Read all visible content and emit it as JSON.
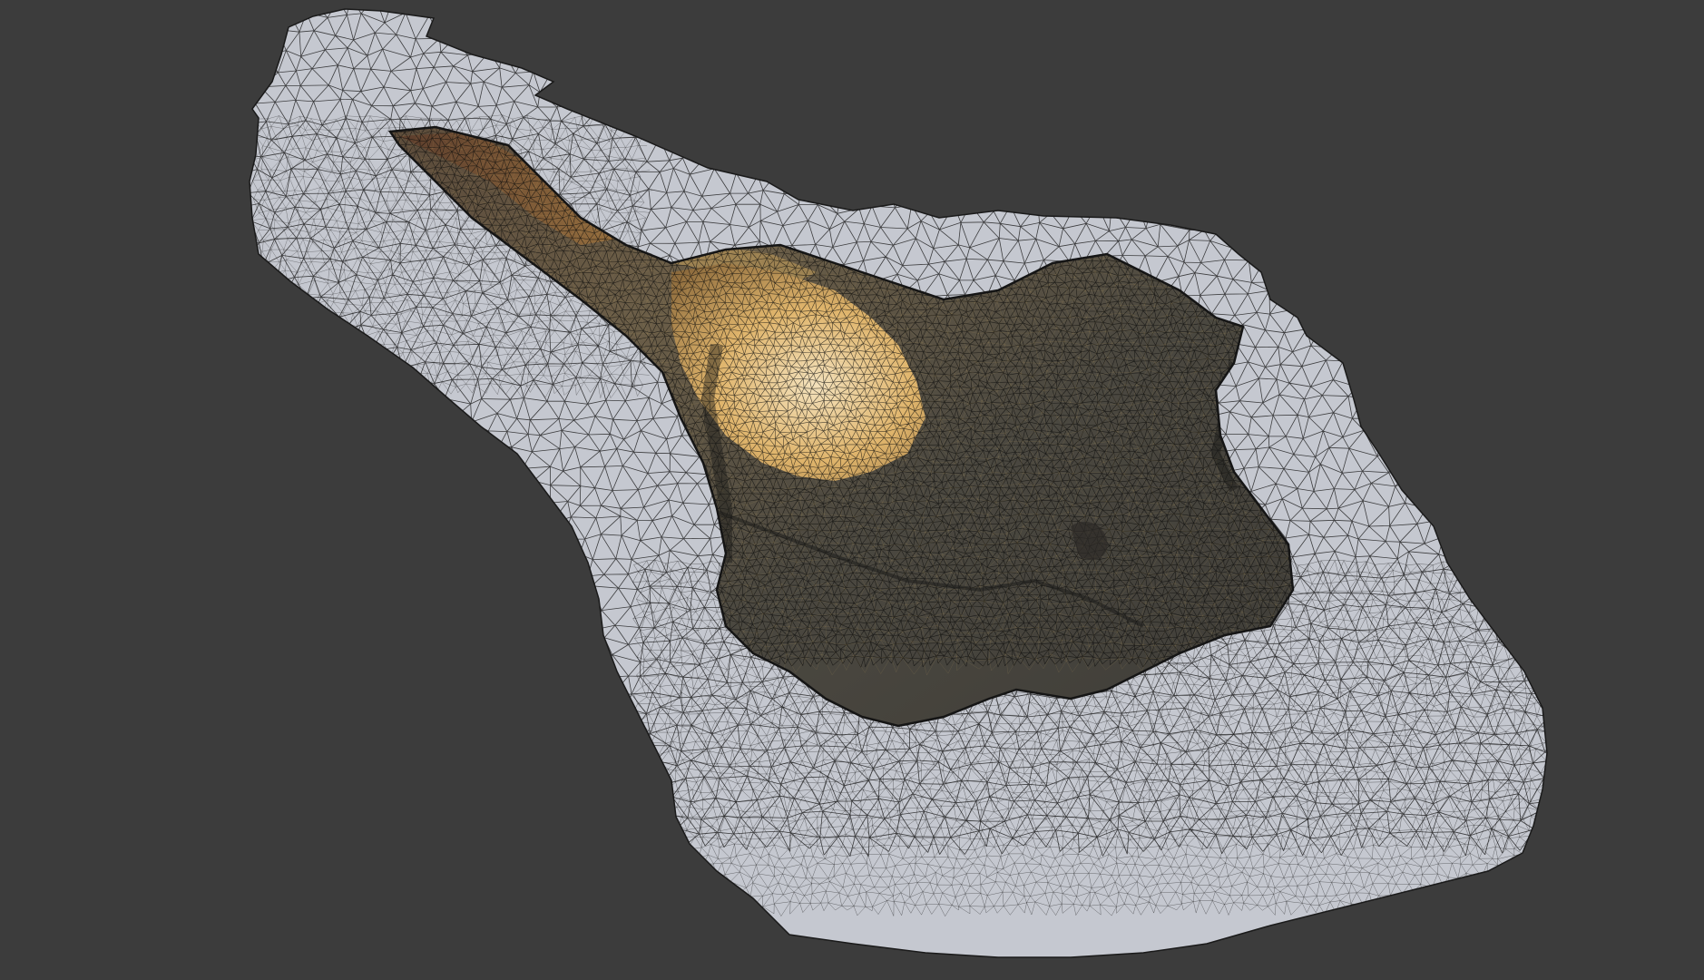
{
  "viewport": {
    "background": "#3c3c3c",
    "render_mode": "wireframe"
  },
  "mesh": {
    "name": "",
    "base_fill": "#c5c8d0",
    "edge_color": "#1a1a1a",
    "rock_fill": "#4a4740",
    "rock_highlight": "#d9b56a",
    "interior_glow": "#f0d7a8"
  }
}
